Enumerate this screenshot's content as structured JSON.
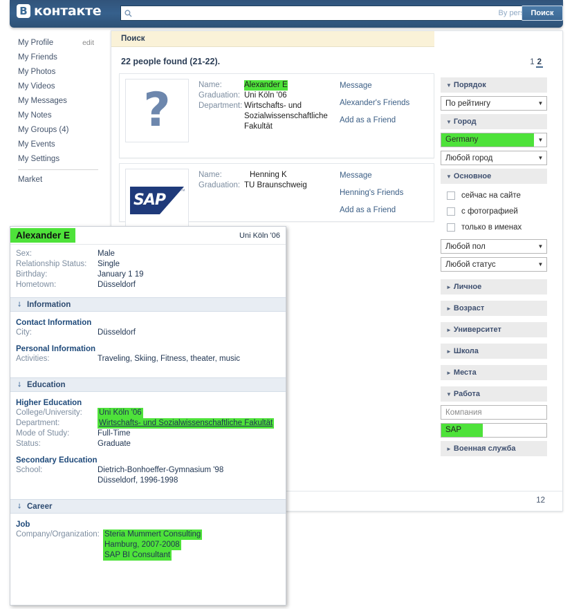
{
  "header": {
    "logo_letter": "В",
    "logo_text": "контакте",
    "search_placeholder": "",
    "search_value": "",
    "search_scope_label": "By person",
    "search_button_label": "Поиск",
    "search_icon": "search-icon",
    "caret_icon": "chevron-down-icon"
  },
  "sidebar": {
    "items": [
      {
        "label": "My Profile",
        "extra": "edit"
      },
      {
        "label": "My Friends",
        "extra": ""
      },
      {
        "label": "My Photos",
        "extra": ""
      },
      {
        "label": "My Videos",
        "extra": ""
      },
      {
        "label": "My Messages",
        "extra": ""
      },
      {
        "label": "My Notes",
        "extra": ""
      },
      {
        "label": "My Groups (4)",
        "extra": ""
      },
      {
        "label": "My Events",
        "extra": ""
      },
      {
        "label": "My Settings",
        "extra": ""
      }
    ],
    "market_label": "Market"
  },
  "main": {
    "tab_title": "Поиск",
    "results_summary": "22 people found (21-22).",
    "pager": {
      "page1": "1",
      "page2": "2",
      "active": "2"
    },
    "results": [
      {
        "avatar_kind": "question-mark",
        "avatar_glyph": "?",
        "fields": [
          {
            "label": "Name:",
            "value": "Alexander E",
            "highlight": true
          },
          {
            "label": "Graduation:",
            "value": "Uni Köln '06",
            "highlight": false
          },
          {
            "label": "Department:",
            "value": "Wirtschafts- und Sozialwissenschaftliche Fakultät",
            "highlight": false
          }
        ],
        "actions": [
          "Message",
          "Alexander's Friends",
          "Add as a Friend"
        ]
      },
      {
        "avatar_kind": "sap-logo",
        "avatar_glyph": "SAP",
        "avatar_tm": "™",
        "fields": [
          {
            "label": "Name:",
            "value": "Henning K",
            "highlight": false
          },
          {
            "label": "Graduation:",
            "value": "TU Braunschweig",
            "highlight": false
          }
        ],
        "actions": [
          "Message",
          "Henning's Friends",
          "Add as a Friend"
        ]
      }
    ]
  },
  "filters": {
    "order": {
      "section": "Порядок",
      "value": "По рейтингу"
    },
    "city": {
      "section": "Город",
      "country_value": "Germany",
      "country_highlight": true,
      "city_value": "Любой город"
    },
    "basic": {
      "section": "Основное",
      "checkboxes": [
        {
          "label": "сейчас на сайте",
          "checked": false
        },
        {
          "label": "с фотографией",
          "checked": false
        },
        {
          "label": "только в именах",
          "checked": false
        }
      ],
      "sex_value": "Любой пол",
      "status_value": "Любой статус"
    },
    "collapsed_sections": [
      "Личное",
      "Возраст",
      "Университет",
      "Школа",
      "Места"
    ],
    "work": {
      "section": "Работа",
      "company_placeholder": "Компания",
      "position_value": "SAP",
      "position_highlight": true
    },
    "military_section": "Военная служба",
    "expanded_icon": "triangle-down-icon",
    "collapsed_icon": "triangle-right-icon"
  },
  "profile": {
    "name": "Alexander E",
    "university": "Uni Köln '06",
    "summary_rows": [
      {
        "label": "Sex:",
        "value": "Male"
      },
      {
        "label": "Relationship Status:",
        "value": "Single"
      },
      {
        "label": "Birthday:",
        "value": "January 1 19"
      },
      {
        "label": "Hometown:",
        "value": "Düsseldorf"
      }
    ],
    "sections": [
      {
        "title": "Information",
        "groups": [
          {
            "heading": "Contact Information",
            "rows": [
              {
                "label": "City:",
                "value": "Düsseldorf"
              }
            ]
          },
          {
            "heading": "Personal Information",
            "rows": [
              {
                "label": "Activities:",
                "value": "Traveling, Skiing, Fitness, theater, music"
              }
            ]
          }
        ]
      },
      {
        "title": "Education",
        "groups": [
          {
            "heading": "Higher Education",
            "rows": [
              {
                "label": "College/University:",
                "value": "Uni Köln '06",
                "highlight": true
              },
              {
                "label": "Department:",
                "value": "Wirtschafts- und Sozialwissenschaftliche Fakultät",
                "highlight": true,
                "underline": true
              },
              {
                "label": "Mode of Study:",
                "value": "Full-Time"
              },
              {
                "label": "Status:",
                "value": "Graduate"
              }
            ]
          },
          {
            "heading": "Secondary Education",
            "rows": [
              {
                "label": "School:",
                "value": "Dietrich-Bonhoeffer-Gymnasium '98"
              },
              {
                "label": "",
                "value": "Düsseldorf, 1996-1998"
              }
            ]
          }
        ]
      },
      {
        "title": "Career",
        "groups": [
          {
            "heading": "Job",
            "rows": [
              {
                "label": "Company/Organization:",
                "value": "Steria Mummert Consulting",
                "highlight": true
              },
              {
                "label": "",
                "value": "Hamburg, 2007-2008",
                "highlight": true
              },
              {
                "label": "",
                "value": "SAP BI Consultant",
                "highlight": true
              }
            ]
          }
        ]
      }
    ]
  },
  "colors": {
    "header_blue": "#36608c",
    "header_dark": "#2b587a",
    "highlight_green": "#4ee23a",
    "tab_cream": "#faf2d8",
    "section_blue": "#e8edf3",
    "link_blue": "#3b5e85"
  }
}
